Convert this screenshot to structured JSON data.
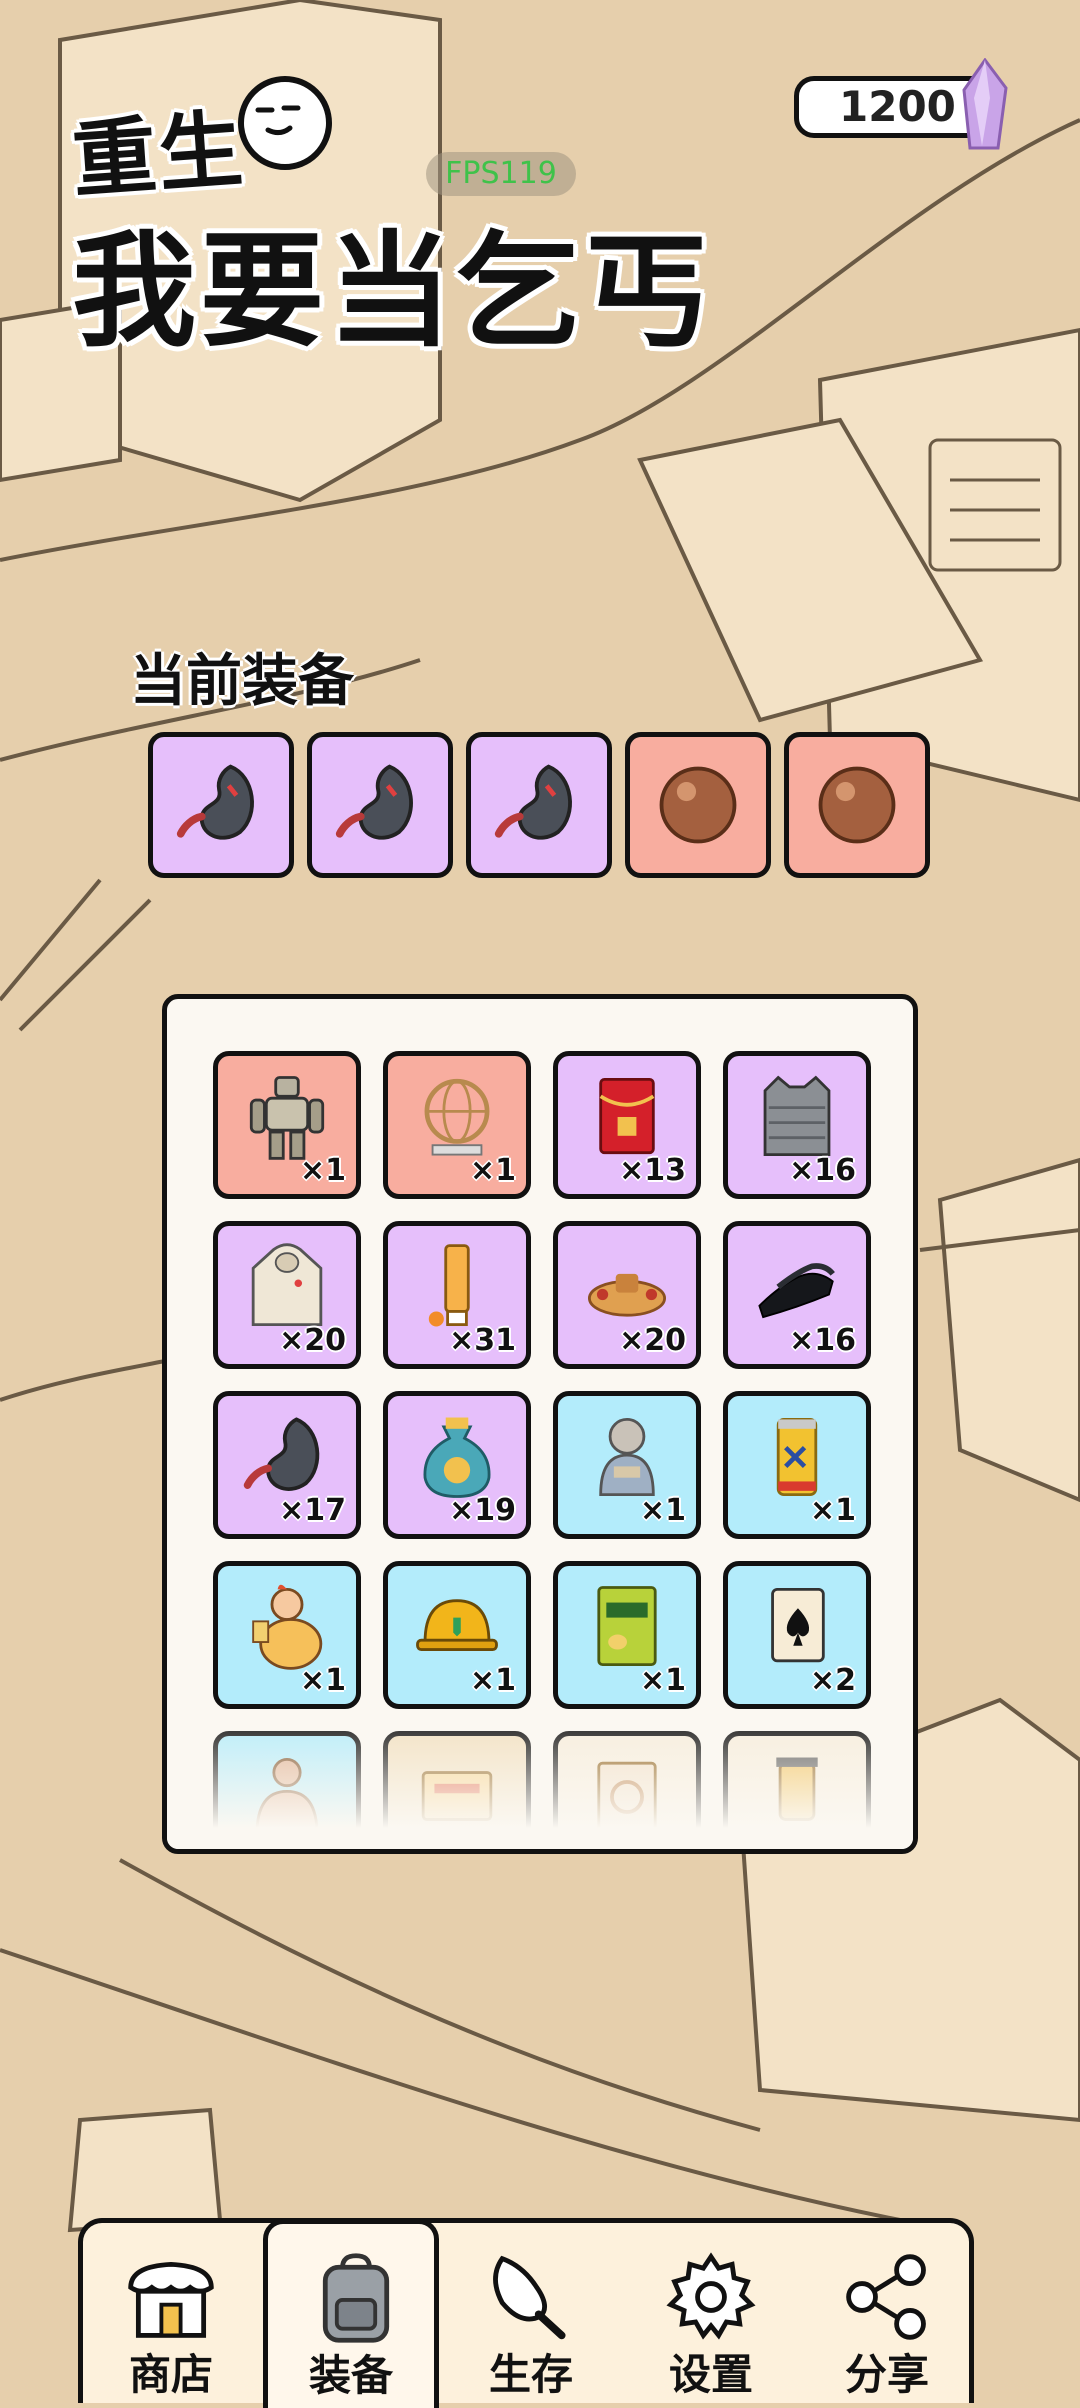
{
  "title": {
    "line1": "重生",
    "line2": "我要当乞丐"
  },
  "fps": "FPS119",
  "currency": {
    "amount": "1200",
    "icon": "purple-gem-icon"
  },
  "equipped": {
    "label": "当前装备",
    "slots": [
      {
        "item": "robot-stomach",
        "rarity": "purple"
      },
      {
        "item": "robot-stomach",
        "rarity": "purple"
      },
      {
        "item": "robot-stomach",
        "rarity": "purple"
      },
      {
        "item": "bronze-ball",
        "rarity": "pink"
      },
      {
        "item": "bronze-ball",
        "rarity": "pink"
      }
    ]
  },
  "inventory": [
    {
      "item": "mech-robot",
      "rarity": "pink",
      "count": "×1"
    },
    {
      "item": "globe-trophy",
      "rarity": "pink",
      "count": "×1"
    },
    {
      "item": "red-envelope",
      "rarity": "purple",
      "count": "×13"
    },
    {
      "item": "armor-vest",
      "rarity": "purple",
      "count": "×16"
    },
    {
      "item": "hoodie",
      "rarity": "purple",
      "count": "×20"
    },
    {
      "item": "sunscreen-tube",
      "rarity": "purple",
      "count": "×31"
    },
    {
      "item": "food-platter",
      "rarity": "purple",
      "count": "×20"
    },
    {
      "item": "black-shoes",
      "rarity": "purple",
      "count": "×16"
    },
    {
      "item": "robot-stomach",
      "rarity": "purple",
      "count": "×17"
    },
    {
      "item": "money-bag",
      "rarity": "purple",
      "count": "×19"
    },
    {
      "item": "buddha-statue",
      "rarity": "blue",
      "count": "×1"
    },
    {
      "item": "energy-drink-can",
      "rarity": "blue",
      "count": "×1"
    },
    {
      "item": "chubby-man-beer",
      "rarity": "blue",
      "count": "×1"
    },
    {
      "item": "hard-hat",
      "rarity": "blue",
      "count": "×1"
    },
    {
      "item": "snack-bag",
      "rarity": "blue",
      "count": "×1"
    },
    {
      "item": "ace-of-spades",
      "rarity": "blue",
      "count": "×2"
    },
    {
      "item": "muscle-man",
      "rarity": "blue",
      "count": ""
    },
    {
      "item": "ticket-card",
      "rarity": "faded",
      "count": ""
    },
    {
      "item": "coin-card",
      "rarity": "faded",
      "count": ""
    },
    {
      "item": "blender-cup",
      "rarity": "faded",
      "count": ""
    }
  ],
  "nav": [
    {
      "label": "商店",
      "icon": "shop-icon",
      "active": false
    },
    {
      "label": "装备",
      "icon": "backpack-icon",
      "active": true
    },
    {
      "label": "生存",
      "icon": "drumstick-icon",
      "active": false
    },
    {
      "label": "设置",
      "icon": "gear-icon",
      "active": false
    },
    {
      "label": "分享",
      "icon": "share-icon",
      "active": false
    }
  ],
  "colors": {
    "background": "#e6cfac",
    "purple_rarity": "#e6bffb",
    "pink_rarity": "#f8ad9f",
    "blue_rarity": "#b3ecfb",
    "fps_text": "#3fc24a"
  }
}
